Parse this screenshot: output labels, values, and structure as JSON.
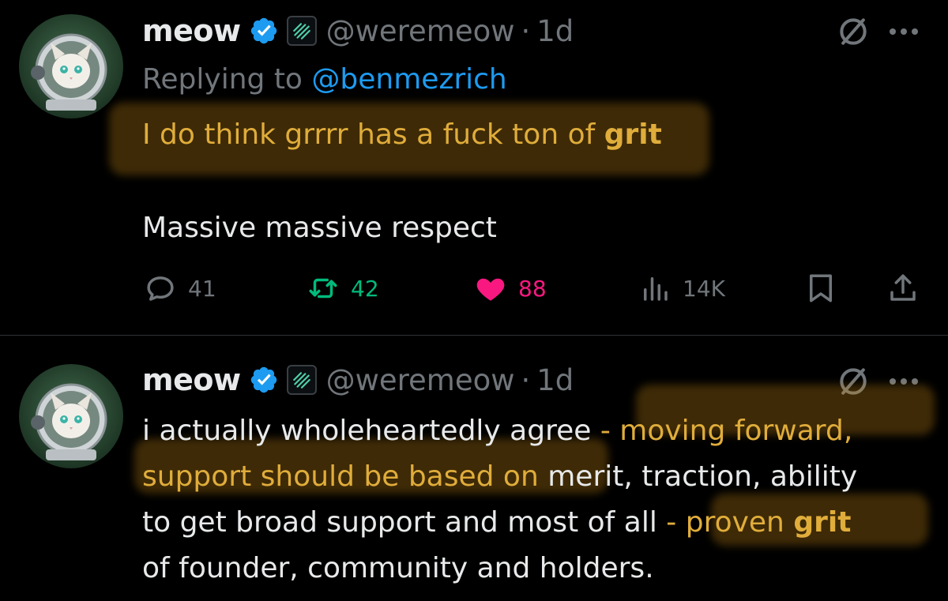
{
  "tweets": [
    {
      "author_name": "meow",
      "handle": "@weremeow",
      "separator": "·",
      "time": "1d",
      "replying_prefix": "Replying to ",
      "replying_to": "@benmezrich",
      "line1_text": "I do think grrrr has a fuck ton of ",
      "line1_bold": "grit",
      "line2": "Massive massive respect",
      "reply_count": "41",
      "repost_count": "42",
      "like_count": "88",
      "view_count": "14K"
    },
    {
      "author_name": "meow",
      "handle": "@weremeow",
      "separator": "·",
      "time": "1d",
      "l1a": "i actually wholeheartedly agree ",
      "l1b": "- moving forward,",
      "l2a": "support should be based on",
      "l2b": " merit, traction, ability",
      "l3a": "to get broad support and most of all ",
      "l3b": "- proven ",
      "l3c": "grit",
      "l4": "of founder, community and holders."
    }
  ],
  "colors": {
    "background": "#000000",
    "text": "#e7e9ea",
    "secondary": "#71767b",
    "mention": "#1d9bf0",
    "highlight": "#e0ad3b",
    "repost": "#00ba7c",
    "like": "#f91880",
    "verified": "#1d9bf0"
  },
  "icons": [
    "verified-badge-icon",
    "affiliate-badge-icon",
    "grok-icon",
    "more-icon",
    "reply-icon",
    "repost-icon",
    "like-heart-icon",
    "views-icon",
    "bookmark-icon",
    "share-icon"
  ]
}
